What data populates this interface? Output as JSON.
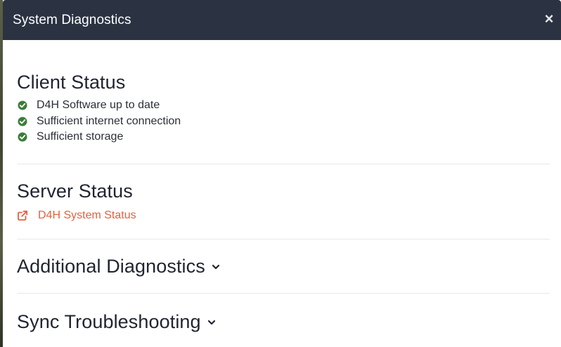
{
  "modal": {
    "title": "System Diagnostics",
    "close_glyph": "×"
  },
  "client_status": {
    "heading": "Client Status",
    "items": [
      {
        "label": "D4H Software up to date",
        "icon": "check-circle-icon",
        "color": "#3b7d3a"
      },
      {
        "label": "Sufficient internet connection",
        "icon": "check-circle-icon",
        "color": "#3b7d3a"
      },
      {
        "label": "Sufficient storage",
        "icon": "check-circle-icon",
        "color": "#3b7d3a"
      }
    ]
  },
  "server_status": {
    "heading": "Server Status",
    "link_label": "D4H System Status",
    "link_icon": "external-link-icon",
    "link_color": "#e2613e"
  },
  "additional_diagnostics": {
    "heading": "Additional Diagnostics",
    "icon": "chevron-down-icon"
  },
  "sync_troubleshooting": {
    "heading": "Sync Troubleshooting",
    "icon": "chevron-down-icon"
  },
  "colors": {
    "header_bg": "#2b3343",
    "success": "#3b7d3a",
    "link": "#e2613e"
  }
}
